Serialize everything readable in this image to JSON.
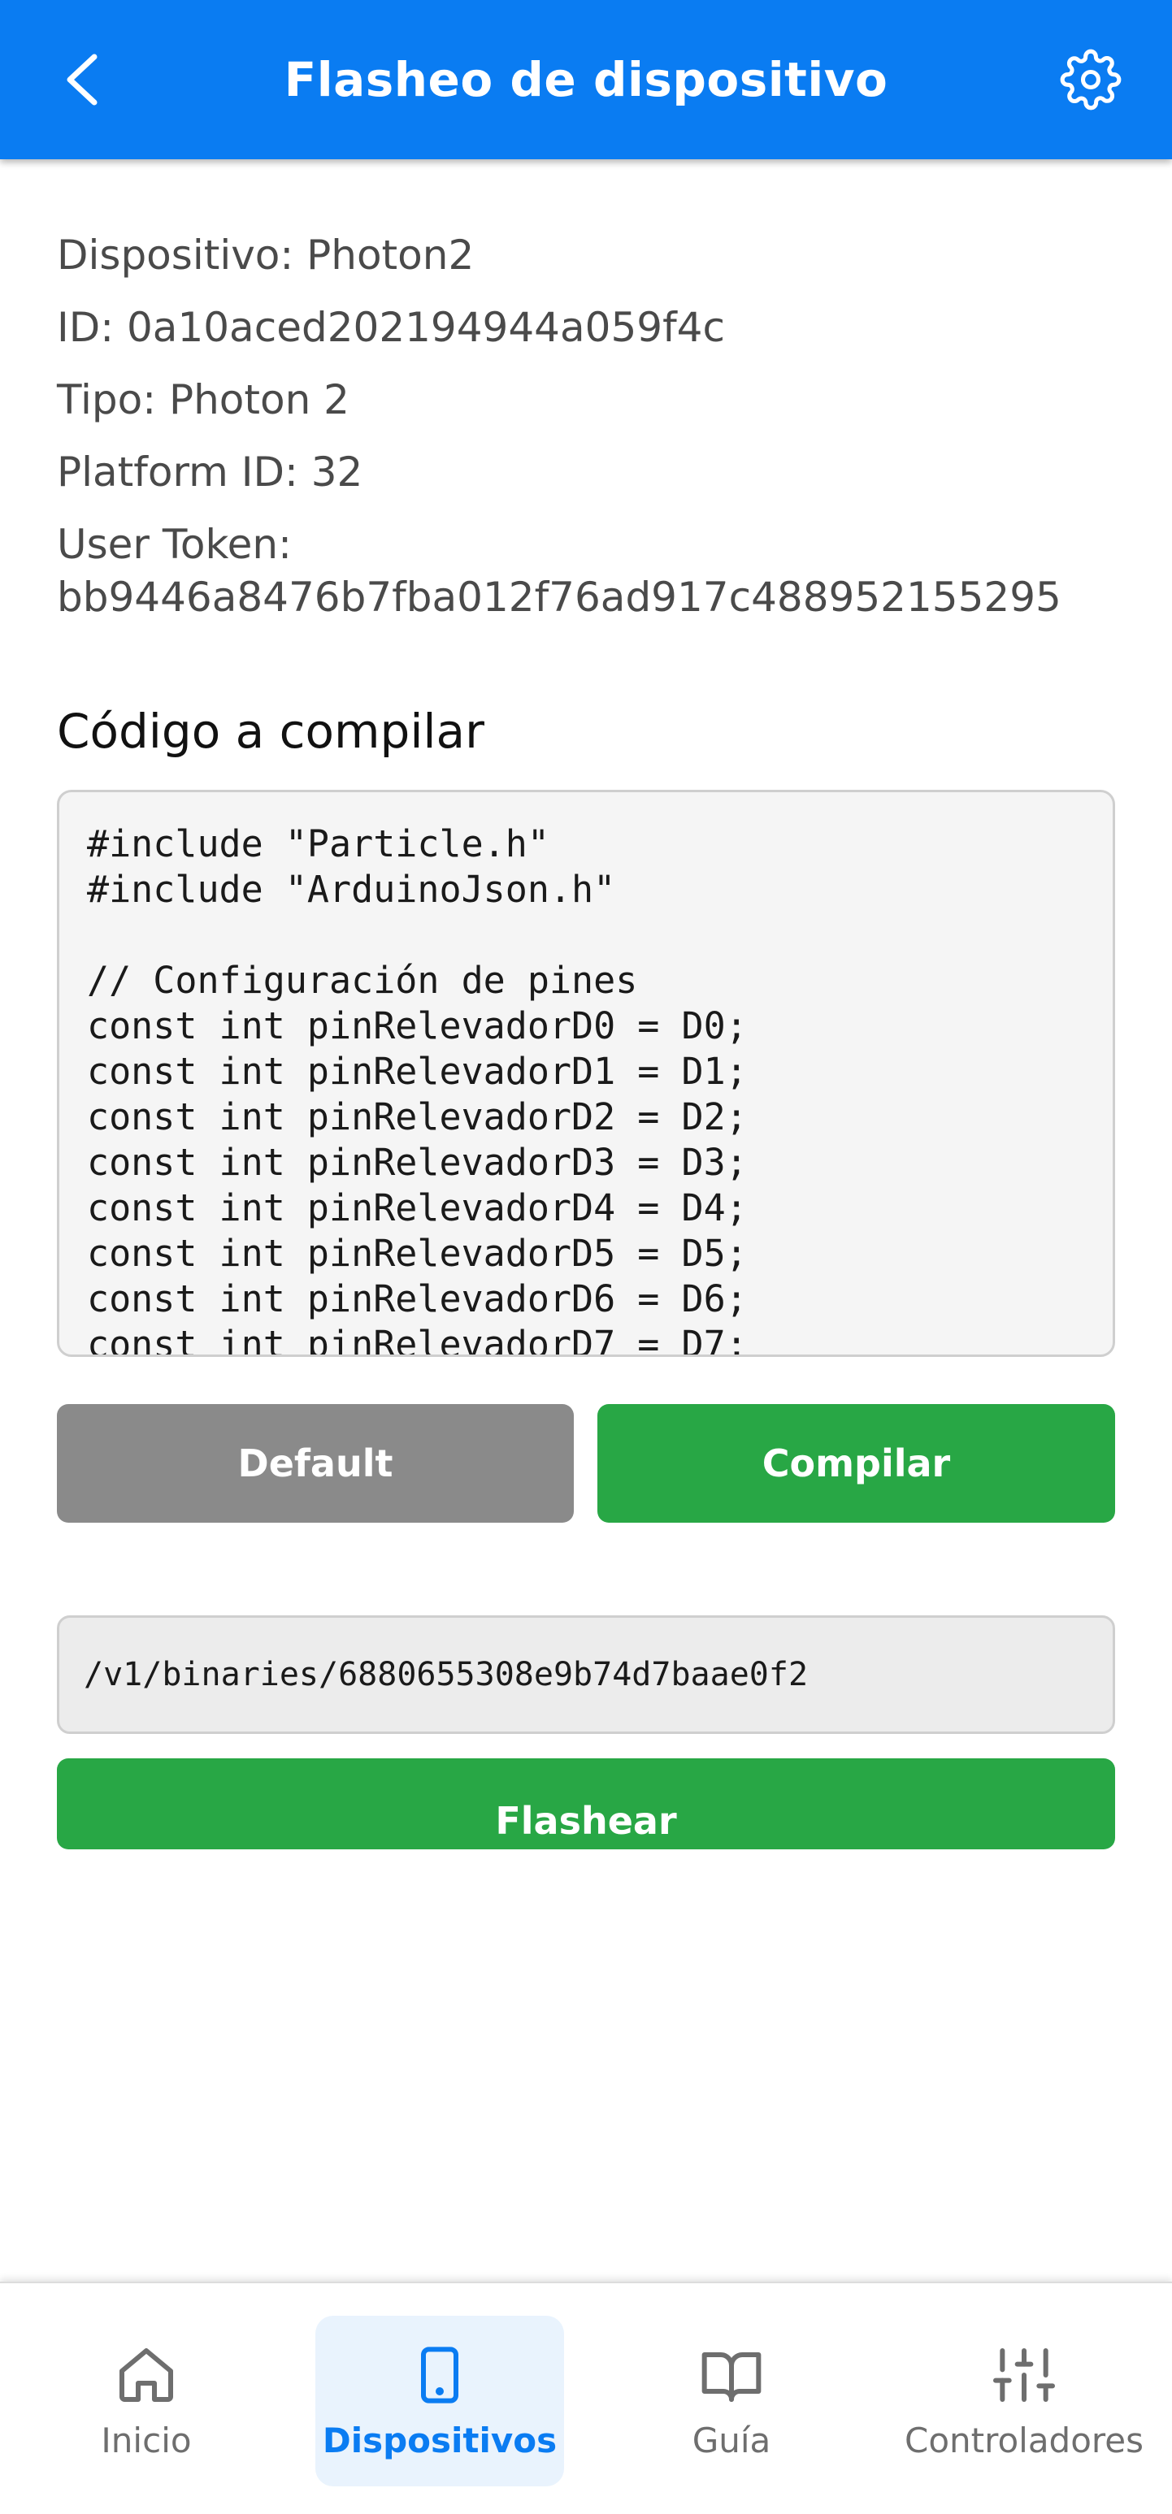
{
  "header": {
    "title": "Flasheo de dispositivo",
    "back_icon": "chevron-left-icon",
    "settings_icon": "gear-icon"
  },
  "device": {
    "name_line": "Dispositivo: Photon2",
    "id_line": "ID: 0a10aced202194944a059f4c",
    "type_line": "Tipo: Photon 2",
    "platform_line": "Platform ID: 32",
    "token_label": "User Token:",
    "token_value": "bb9446a8476b7fba012f76ad917c488952155295"
  },
  "code_section": {
    "title": "Código a compilar",
    "code": "#include \"Particle.h\"\n#include \"ArduinoJson.h\"\n\n// Configuración de pines\nconst int pinRelevadorD0 = D0;\nconst int pinRelevadorD1 = D1;\nconst int pinRelevadorD2 = D2;\nconst int pinRelevadorD3 = D3;\nconst int pinRelevadorD4 = D4;\nconst int pinRelevadorD5 = D5;\nconst int pinRelevadorD6 = D6;\nconst int pinRelevadorD7 = D7;"
  },
  "buttons": {
    "default_label": "Default",
    "compile_label": "Compilar",
    "flash_label": "Flashear"
  },
  "binary": {
    "value": "/v1/binaries/6880655308e9b74d7baae0f2"
  },
  "colors": {
    "header_blue": "#0a7cf2",
    "success_green": "#28a745",
    "default_gray": "#8a8a8a"
  },
  "bottom_nav": {
    "items": [
      {
        "label": "Inicio",
        "icon": "home-icon",
        "active": false
      },
      {
        "label": "Dispositivos",
        "icon": "tablet-icon",
        "active": true
      },
      {
        "label": "Guía",
        "icon": "book-icon",
        "active": false
      },
      {
        "label": "Controladores",
        "icon": "sliders-icon",
        "active": false
      }
    ]
  }
}
